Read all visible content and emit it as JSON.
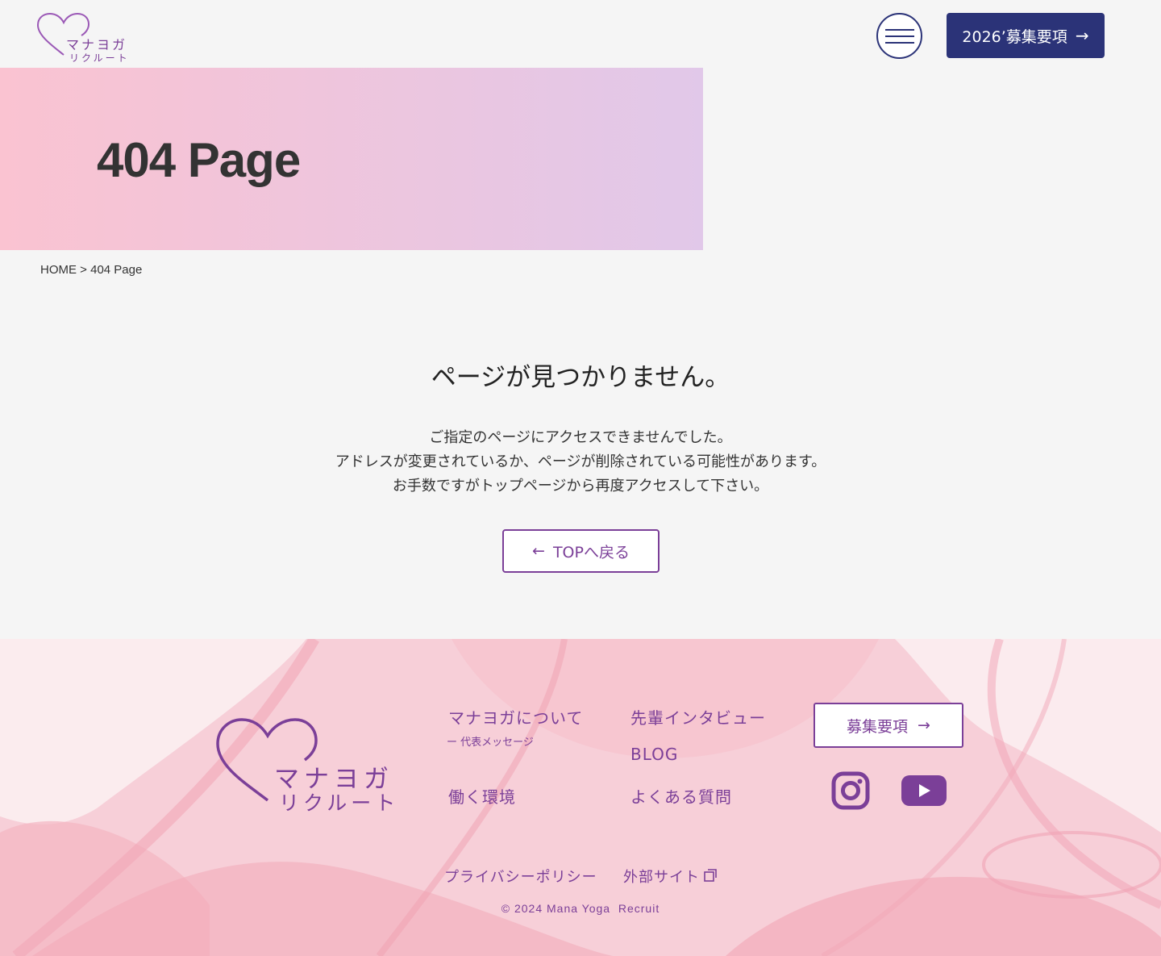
{
  "header": {
    "logo": {
      "line1": "マナヨガ",
      "line2": "リクルート"
    },
    "menu_label": "menu",
    "recruit_button": "2026’募集要項",
    "arrow": "→"
  },
  "hero": {
    "title": "404 Page"
  },
  "breadcrumb": {
    "home": "HOME",
    "separator": " > ",
    "current": "404 Page"
  },
  "main": {
    "title": "ページが見つかりません。",
    "lines": [
      "ご指定のページにアクセスできませんでした。",
      "アドレスが変更されているか、ページが削除されている可能性があります。",
      "お手数ですがトップページから再度アクセスして下さい。"
    ],
    "back_arrow": "←",
    "back_button": "TOPへ戻る"
  },
  "footer": {
    "logo": {
      "line1": "マナヨガ",
      "line2": "リクルート"
    },
    "nav": {
      "about": "マナヨガについて",
      "about_sub": "ー 代表メッセージ",
      "interview": "先輩インタビュー",
      "blog": "BLOG",
      "environment": "働く環境",
      "faq": "よくある質問"
    },
    "recruit_button": "募集要項",
    "arrow": "→",
    "privacy": "プライバシーポリシー",
    "external": "外部サイト",
    "copyright": "© 2024 Mana Yoga  Recruit"
  },
  "colors": {
    "navy": "#2b3378",
    "purple": "#7b3f98",
    "hero_start": "#fac3d1",
    "hero_end": "#e1c8e9"
  },
  "icons": [
    "heart-logo-icon",
    "hamburger-icon",
    "arrow-right-icon",
    "arrow-left-icon",
    "instagram-icon",
    "youtube-icon",
    "external-link-icon"
  ]
}
